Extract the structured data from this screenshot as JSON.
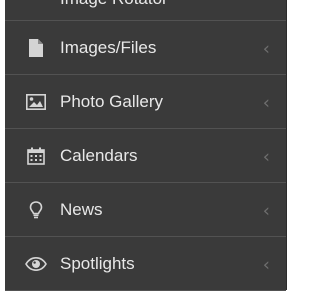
{
  "menu": {
    "partial_item": {
      "label": "Image Rotator"
    },
    "items": [
      {
        "label": "Images/Files",
        "icon": "file-icon",
        "chevron": "‹"
      },
      {
        "label": "Photo Gallery",
        "icon": "image-icon",
        "chevron": "‹"
      },
      {
        "label": "Calendars",
        "icon": "calendar-icon",
        "chevron": "‹"
      },
      {
        "label": "News",
        "icon": "lightbulb-icon",
        "chevron": "‹"
      },
      {
        "label": "Spotlights",
        "icon": "eye-icon",
        "chevron": "‹"
      }
    ]
  },
  "colors": {
    "background": "#3a3a3a",
    "text": "#e8e8e8",
    "icon": "#d4d4d4",
    "divider": "#525252",
    "chevron": "#6e6e6e"
  }
}
